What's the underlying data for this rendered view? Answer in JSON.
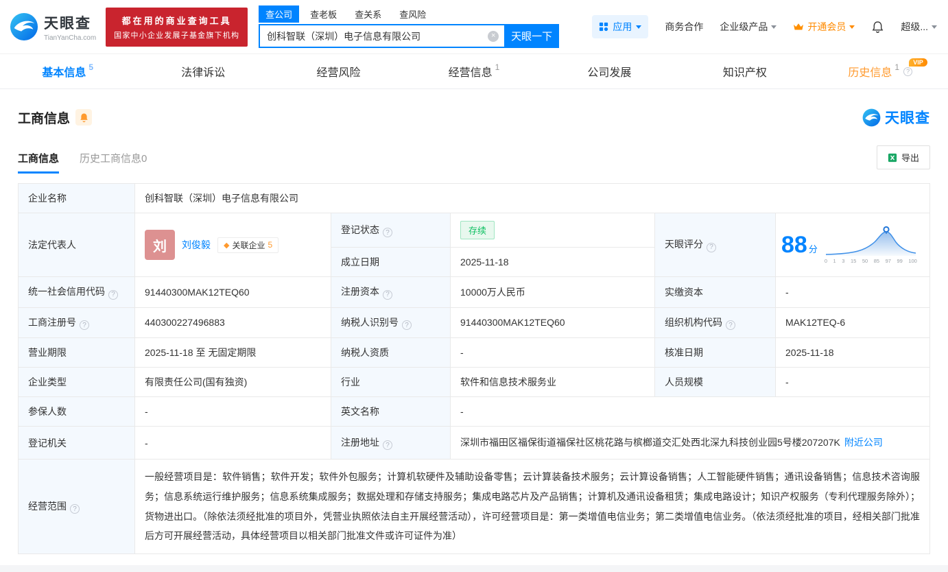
{
  "icons": {
    "help": "?",
    "clear": "×",
    "related_badge": "◆"
  },
  "header": {
    "logo": {
      "title": "天眼查",
      "domain": "TianYanCha.com"
    },
    "banner": {
      "line1": "都在用的商业查询工具",
      "line2": "国家中小企业发展子基金旗下机构"
    },
    "search": {
      "tabs": [
        {
          "label": "查公司"
        },
        {
          "label": "查老板"
        },
        {
          "label": "查关系"
        },
        {
          "label": "查风险"
        }
      ],
      "value": "创科智联（深圳）电子信息有限公司",
      "button": "天眼一下"
    },
    "menu": {
      "apps": "应用",
      "cooperation": "商务合作",
      "enterprise": "企业级产品",
      "vip": "开通会员",
      "super": "超级..."
    }
  },
  "nav_tabs": [
    {
      "label": "基本信息",
      "count": "5"
    },
    {
      "label": "法律诉讼",
      "count": ""
    },
    {
      "label": "经营风险",
      "count": ""
    },
    {
      "label": "经营信息",
      "count": "1"
    },
    {
      "label": "公司发展",
      "count": ""
    },
    {
      "label": "知识产权",
      "count": ""
    },
    {
      "label": "历史信息",
      "count": "1",
      "badge": "VIP"
    }
  ],
  "section": {
    "title": "工商信息",
    "brand": "天眼查",
    "sub_tabs": [
      {
        "label": "工商信息"
      },
      {
        "label": "历史工商信息0"
      }
    ],
    "export_label": "导出"
  },
  "fields": {
    "company_name": {
      "label": "企业名称",
      "value": "创科智联（深圳）电子信息有限公司"
    },
    "legal_rep": {
      "label": "法定代表人",
      "avatar": "刘",
      "name": "刘俊毅",
      "tag_label": "关联企业",
      "tag_count": "5"
    },
    "reg_status": {
      "label": "登记状态",
      "value": "存续"
    },
    "establish_date": {
      "label": "成立日期",
      "value": "2025-11-18"
    },
    "score": {
      "label": "天眼评分",
      "value": "88",
      "unit": "分",
      "axis": [
        "0",
        "1",
        "3",
        "15",
        "50",
        "85",
        "97",
        "99",
        "100"
      ]
    },
    "credit_code": {
      "label": "统一社会信用代码",
      "value": "91440300MAK12TEQ60"
    },
    "reg_capital": {
      "label": "注册资本",
      "value": "10000万人民币"
    },
    "paid_capital": {
      "label": "实缴资本",
      "value": "-"
    },
    "reg_number": {
      "label": "工商注册号",
      "value": "440300227496883"
    },
    "taxpayer_id": {
      "label": "纳税人识别号",
      "value": "91440300MAK12TEQ60"
    },
    "org_code": {
      "label": "组织机构代码",
      "value": "MAK12TEQ-6"
    },
    "business_term": {
      "label": "营业期限",
      "value": "2025-11-18 至 无固定期限"
    },
    "taxpayer_quality": {
      "label": "纳税人资质",
      "value": "-"
    },
    "approval_date": {
      "label": "核准日期",
      "value": "2025-11-18"
    },
    "company_type": {
      "label": "企业类型",
      "value": "有限责任公司(国有独资)"
    },
    "industry": {
      "label": "行业",
      "value": "软件和信息技术服务业"
    },
    "staff_size": {
      "label": "人员规模",
      "value": "-"
    },
    "insured_count": {
      "label": "参保人数",
      "value": "-"
    },
    "english_name": {
      "label": "英文名称",
      "value": "-"
    },
    "reg_authority": {
      "label": "登记机关",
      "value": "-"
    },
    "reg_address": {
      "label": "注册地址",
      "value": "深圳市福田区福保街道福保社区桃花路与槟榔道交汇处西北深九科技创业园5号楼207207K",
      "link": "附近公司"
    },
    "business_scope": {
      "label": "经营范围",
      "value": "一般经营项目是：软件销售；软件开发；软件外包服务；计算机软硬件及辅助设备零售；云计算装备技术服务；云计算设备销售；人工智能硬件销售；通讯设备销售；信息技术咨询服务；信息系统运行维护服务；信息系统集成服务；数据处理和存储支持服务；集成电路芯片及产品销售；计算机及通讯设备租赁；集成电路设计；知识产权服务（专利代理服务除外）；货物进出口。（除依法须经批准的项目外，凭营业执照依法自主开展经营活动），许可经营项目是：第一类增值电信业务；第二类增值电信业务。（依法须经批准的项目，经相关部门批准后方可开展经营活动，具体经营项目以相关部门批准文件或许可证件为准）"
    }
  }
}
